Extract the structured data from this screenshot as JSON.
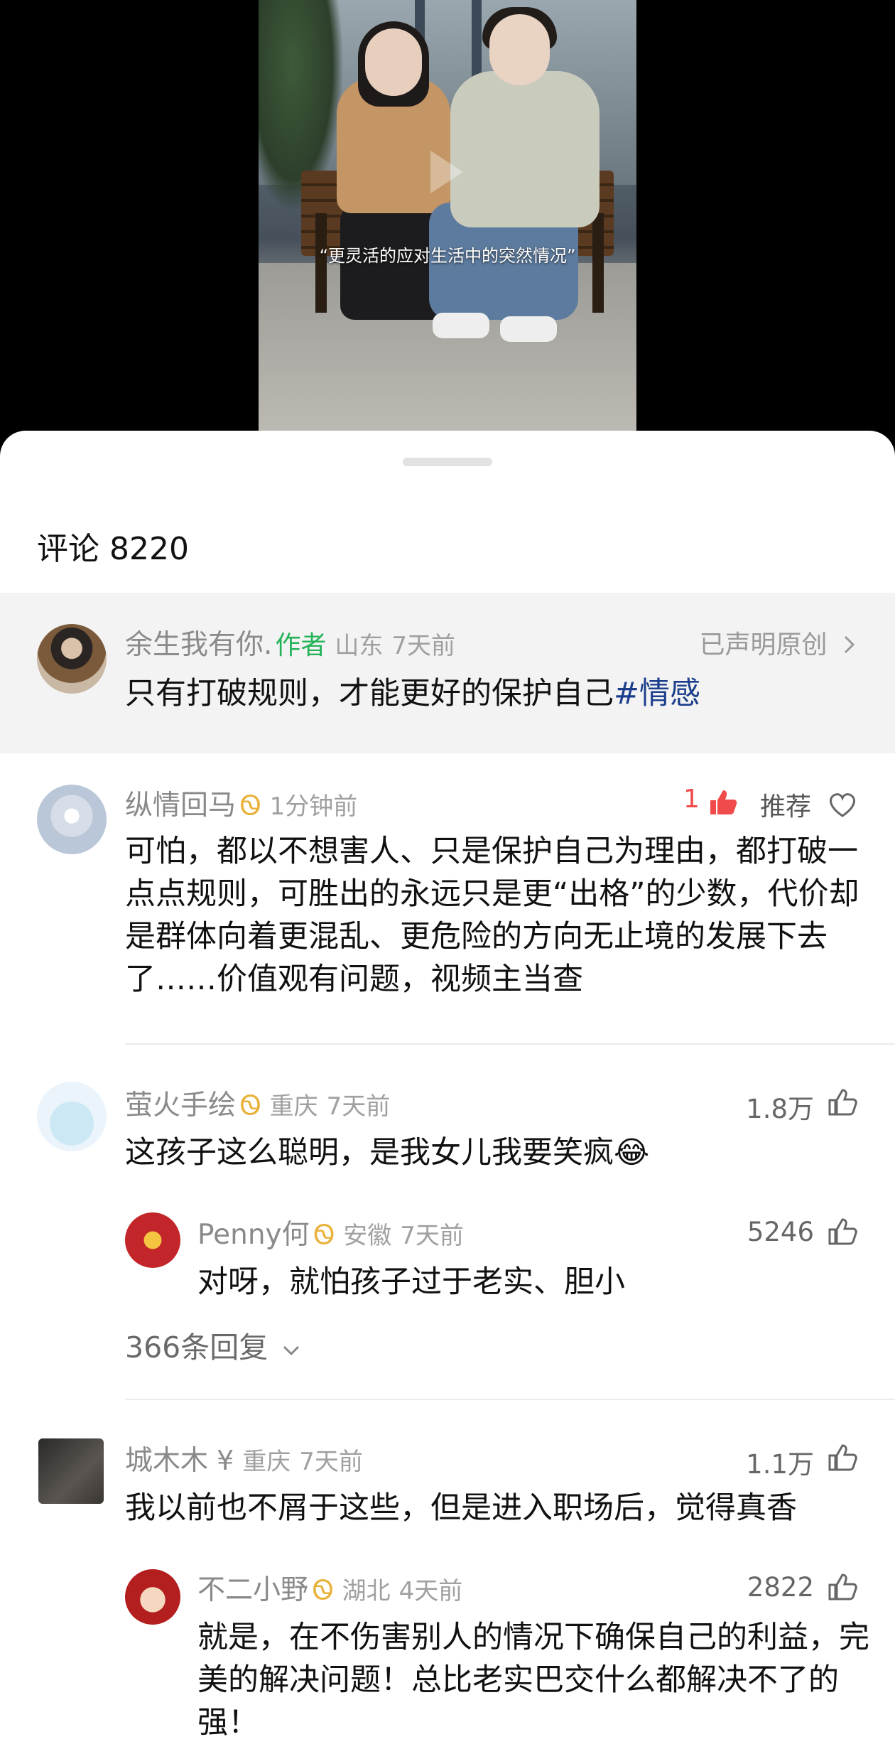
{
  "video": {
    "subtitle": "“更灵活的应对生活中的突然情况”"
  },
  "comments_header": {
    "title": "评论 8220"
  },
  "author_post": {
    "name": "余生我有你.",
    "badge": "作者",
    "location": "山东",
    "time": "7天前",
    "original_label": "已声明原创",
    "text": "只有打破规则，才能更好的保护自己",
    "hashtag": "#情感"
  },
  "comments": [
    {
      "name": "纵情回马",
      "time": "1分钟前",
      "likes": "1",
      "recommend": "推荐",
      "text": "可怕，都以不想害人、只是保护自己为理由，都打破一点点规则，可胜出的永远只是更“出格”的少数，代价却是群体向着更混乱、更危险的方向无止境的发展下去了……价值观有问题，视频主当查"
    },
    {
      "name": "萤火手绘",
      "location": "重庆",
      "time": "7天前",
      "likes": "1.8万",
      "text": "这孩子这么聪明，是我女儿我要笑疯😂",
      "reply": {
        "name": "Penny何",
        "location": "安徽",
        "time": "7天前",
        "likes": "5246",
        "text": "对呀，就怕孩子过于老实、胆小"
      },
      "more_replies": "366条回复"
    },
    {
      "name": "城木木",
      "currency": "¥",
      "location": "重庆",
      "time": "7天前",
      "likes": "1.1万",
      "text": "我以前也不屑于这些，但是进入职场后，觉得真香",
      "reply": {
        "name": "不二小野",
        "location": "湖北",
        "time": "4天前",
        "likes": "2822",
        "text": "就是，在不伤害别人的情况下确保自己的利益，完美的解决问题！总比老实巴交什么都解决不了的强！"
      }
    }
  ],
  "icons": {
    "vip": "butterfly-icon",
    "like": "thumb-up-icon",
    "heart": "heart-icon",
    "chevron": "chevron-right-icon"
  },
  "colors": {
    "author_tag": "#25b35a",
    "vip": "#e8b23a",
    "liked": "#f04b4b",
    "hashtag": "#1b3e8c"
  }
}
